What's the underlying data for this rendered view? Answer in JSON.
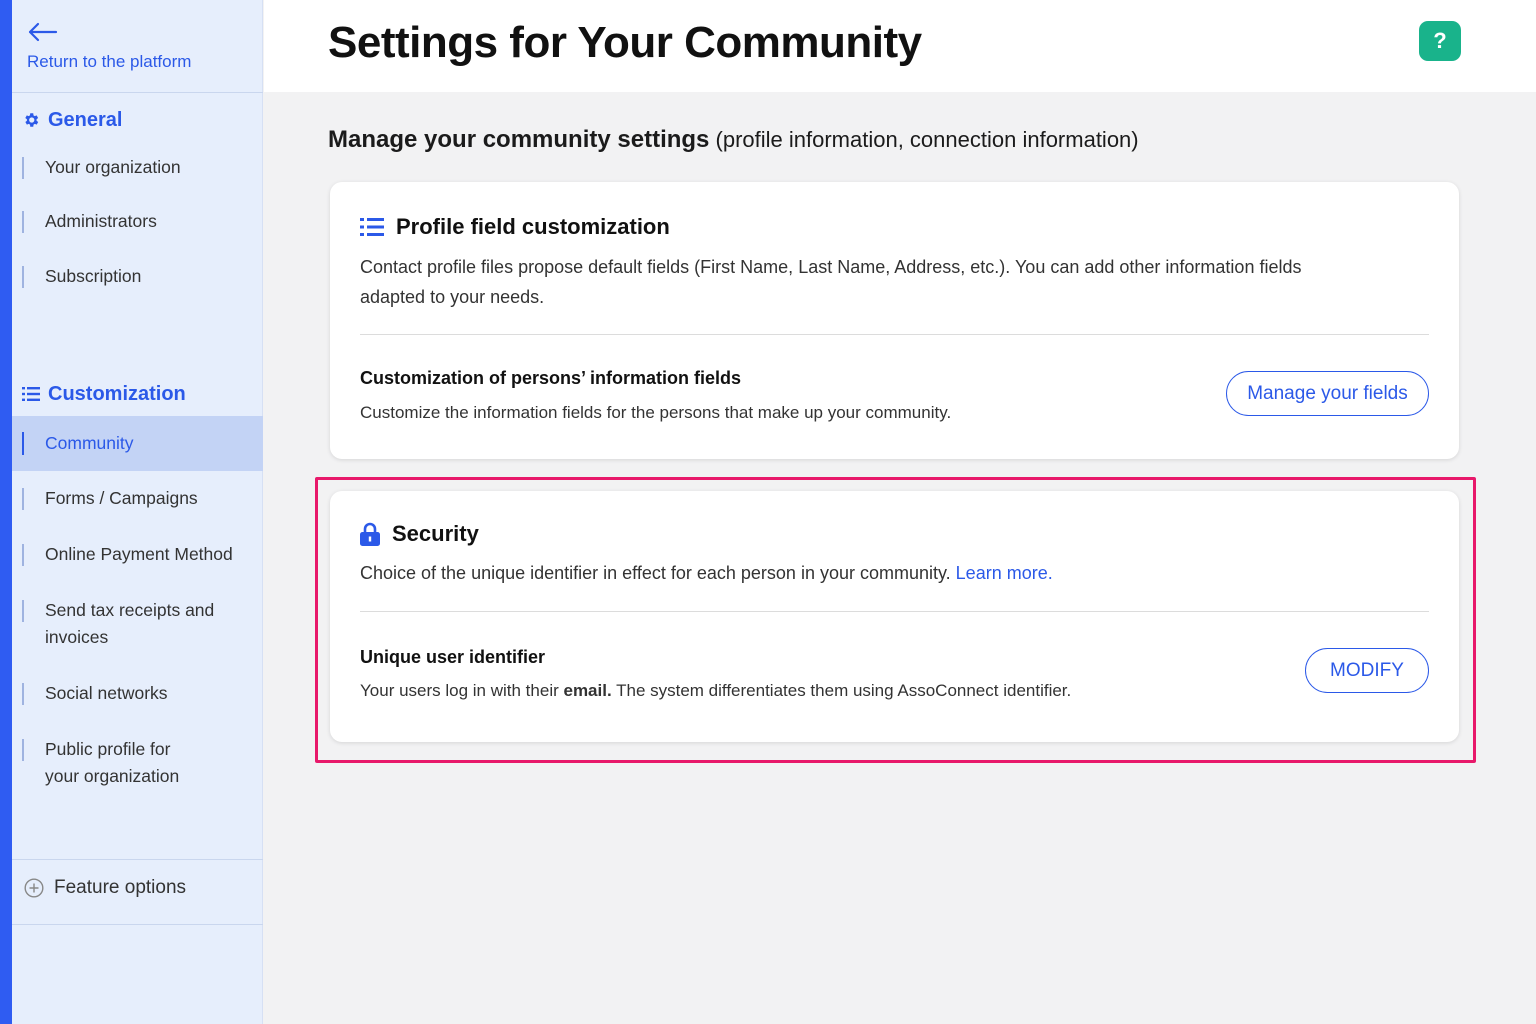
{
  "sidebar": {
    "back_label": "Return to the platform",
    "sections": {
      "general": "General",
      "customization": "Customization"
    },
    "general_items": [
      {
        "label": "Your organization"
      },
      {
        "label": "Administrators"
      },
      {
        "label": "Subscription"
      }
    ],
    "custom_items": [
      {
        "label": "Community",
        "active": true
      },
      {
        "label": "Forms / Campaigns"
      },
      {
        "label": "Online Payment Method"
      },
      {
        "label": "Send tax receipts and invoices"
      },
      {
        "label": "Social networks"
      },
      {
        "label": "Public profile for your organization"
      }
    ],
    "feature_options": "Feature options"
  },
  "header": {
    "title": "Settings for Your Community",
    "help_label": "?"
  },
  "main": {
    "subtitle_strong": "Manage your community settings",
    "subtitle_rest": " (profile information, connection information)",
    "profile_card": {
      "title": "Profile field customization",
      "description": "Contact profile files propose default fields (First Name, Last Name, Address, etc.). You can add other information fields adapted to your needs.",
      "row_title": "Customization of persons’ information fields",
      "row_description": "Customize the information fields for the persons that make up your community.",
      "button_label": "Manage your fields"
    },
    "security_card": {
      "title": "Security",
      "description": "Choice of the unique identifier in effect for each person in your community. ",
      "learn_more": "Learn more.",
      "row_title": "Unique user identifier",
      "row_desc_before": "Your users log in with their ",
      "row_desc_bold": "email.",
      "row_desc_after": " The system differentiates them using AssoConnect identifier.",
      "button_label": "MODIFY"
    }
  },
  "colors": {
    "accent": "#2b59e8",
    "help_button": "#19b38b",
    "highlight_border": "#e8196a",
    "sidebar_bg": "#e6eefc",
    "active_item_bg": "#c3d3f5"
  }
}
